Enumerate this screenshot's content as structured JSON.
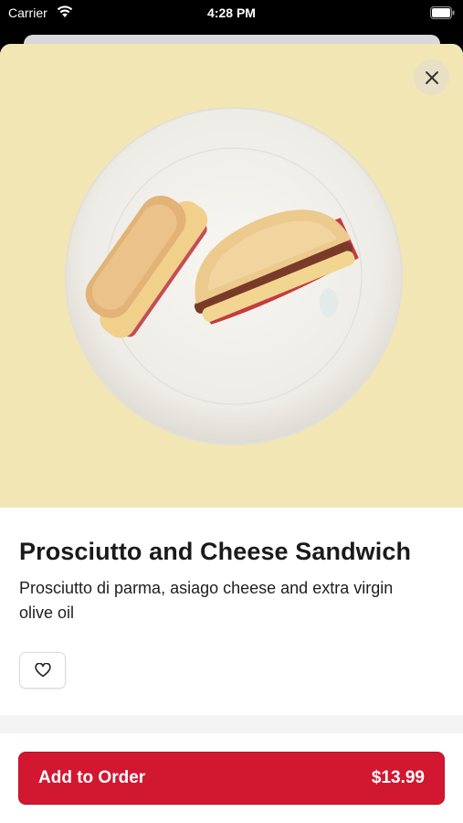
{
  "status_bar": {
    "carrier": "Carrier",
    "time": "4:28 PM"
  },
  "product": {
    "title": "Prosciutto and Cheese Sandwich",
    "description": "Prosciutto di parma, asiago cheese and extra virgin olive oil",
    "hero_background": "#f2e6b5"
  },
  "actions": {
    "add_to_order_label": "Add to Order",
    "price": "$13.99",
    "accent_color": "#d21731"
  },
  "icons": {
    "close": "close-icon",
    "favorite": "heart-outline-icon"
  }
}
